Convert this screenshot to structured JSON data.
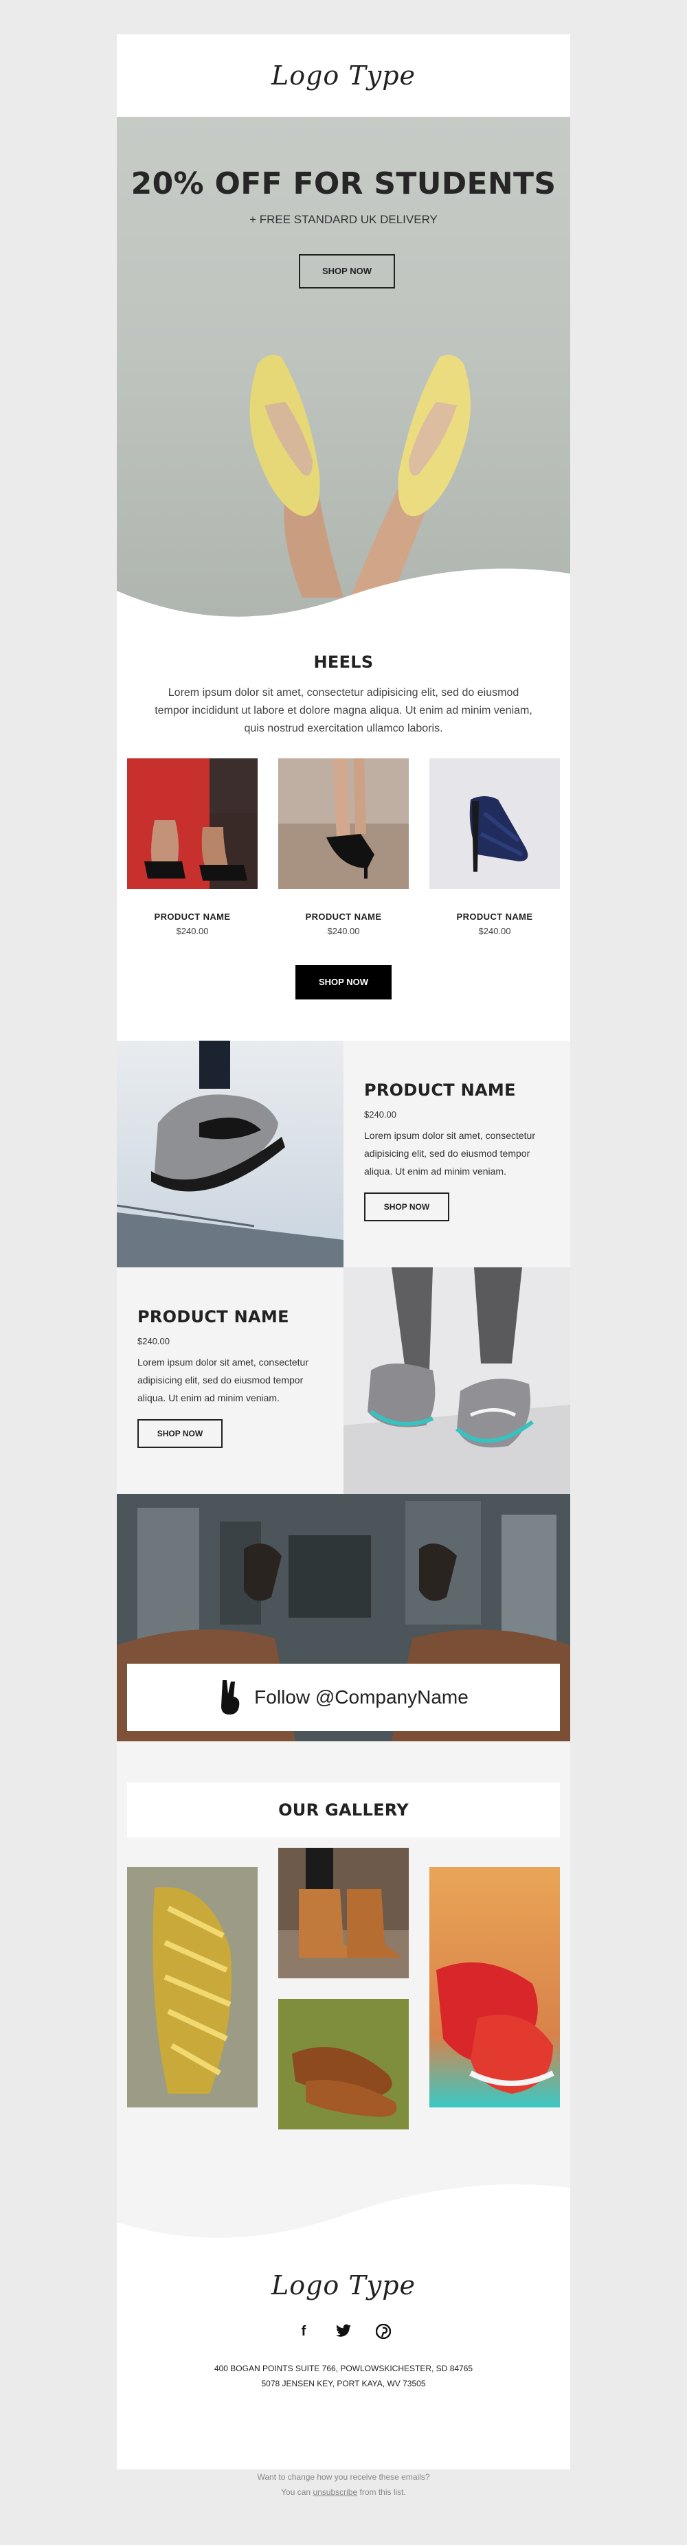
{
  "header": {
    "logo": "Logo Type"
  },
  "hero": {
    "title": "20% OFF FOR STUDENTS",
    "subtitle": "+ FREE STANDARD UK DELIVERY",
    "button": "SHOP NOW"
  },
  "heels": {
    "title": "HEELS",
    "text": "Lorem ipsum dolor sit amet, consectetur adipisicing elit, sed do eiusmod tempor incididunt ut labore et dolore magna aliqua. Ut enim ad minim veniam, quis nostrud exercitation ullamco laboris.",
    "products": [
      {
        "name": "PRODUCT NAME",
        "price": "$240.00"
      },
      {
        "name": "PRODUCT NAME",
        "price": "$240.00"
      },
      {
        "name": "PRODUCT NAME",
        "price": "$240.00"
      }
    ],
    "button": "SHOP NOW"
  },
  "feature1": {
    "title": "PRODUCT NAME",
    "price": "$240.00",
    "desc": "Lorem ipsum dolor sit amet, consectetur adipisicing elit, sed do eiusmod tempor aliqua. Ut enim ad minim veniam.",
    "button": "SHOP NOW"
  },
  "feature2": {
    "title": "PRODUCT NAME",
    "price": "$240.00",
    "desc": "Lorem ipsum dolor sit amet, consectetur adipisicing elit, sed do eiusmod tempor aliqua. Ut enim ad minim veniam.",
    "button": "SHOP NOW"
  },
  "follow": {
    "text": "Follow @CompanyName",
    "icon": "peace-hand-icon"
  },
  "gallery": {
    "title": "OUR GALLERY"
  },
  "footer": {
    "logo": "Logo Type",
    "socials": [
      "facebook-icon",
      "twitter-icon",
      "pinterest-icon"
    ],
    "address_line1": "400 BOGAN POINTS SUITE 766, POWLOWSKICHESTER, SD 84765",
    "address_line2": "5078 JENSEN KEY, PORT KAYA, WV 73505"
  },
  "bottom": {
    "question": "Want to change how you receive these emails?",
    "prefix": "You can",
    "link": "unsubscribe",
    "suffix": "from this list."
  }
}
